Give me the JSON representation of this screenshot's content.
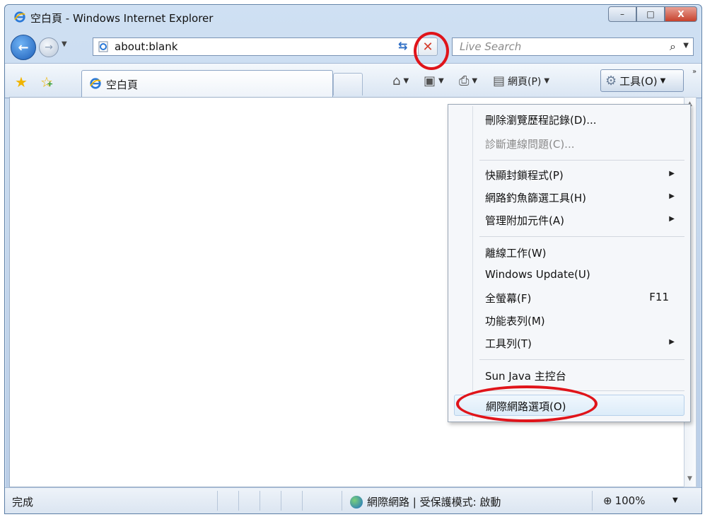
{
  "window": {
    "title": "空白頁 - Windows Internet Explorer"
  },
  "caption": {
    "minimize": "–",
    "maximize": "□",
    "close": "X"
  },
  "nav": {
    "address": "about:blank",
    "search_placeholder": "Live Search",
    "stop_glyph": "✕",
    "refresh_glyph": "⇆"
  },
  "tabs": [
    {
      "label": "空白頁"
    }
  ],
  "commands": {
    "page_label": "網頁(P)",
    "tools_label": "工具(O)"
  },
  "tools_menu": {
    "items": [
      {
        "label": "刪除瀏覽歷程記錄(D)...",
        "enabled": true
      },
      {
        "label": "診斷連線問題(C)...",
        "enabled": false
      },
      {
        "label": "快顯封鎖程式(P)",
        "submenu": true
      },
      {
        "label": "網路釣魚篩選工具(H)",
        "submenu": true
      },
      {
        "label": "管理附加元件(A)",
        "submenu": true
      },
      {
        "label": "離線工作(W)"
      },
      {
        "label": "Windows Update(U)"
      },
      {
        "label": "全螢幕(F)",
        "shortcut": "F11"
      },
      {
        "label": "功能表列(M)"
      },
      {
        "label": "工具列(T)",
        "submenu": true
      },
      {
        "label": "Sun Java 主控台"
      },
      {
        "label": "網際網路選項(O)",
        "highlighted": true
      }
    ]
  },
  "status": {
    "text": "完成",
    "zone": "網際網路 | 受保護模式: 啟動",
    "zoom": "100%"
  },
  "annotations": {
    "color": "#e0141a",
    "circled": [
      "stop-button",
      "menu-item-internet-options"
    ]
  }
}
